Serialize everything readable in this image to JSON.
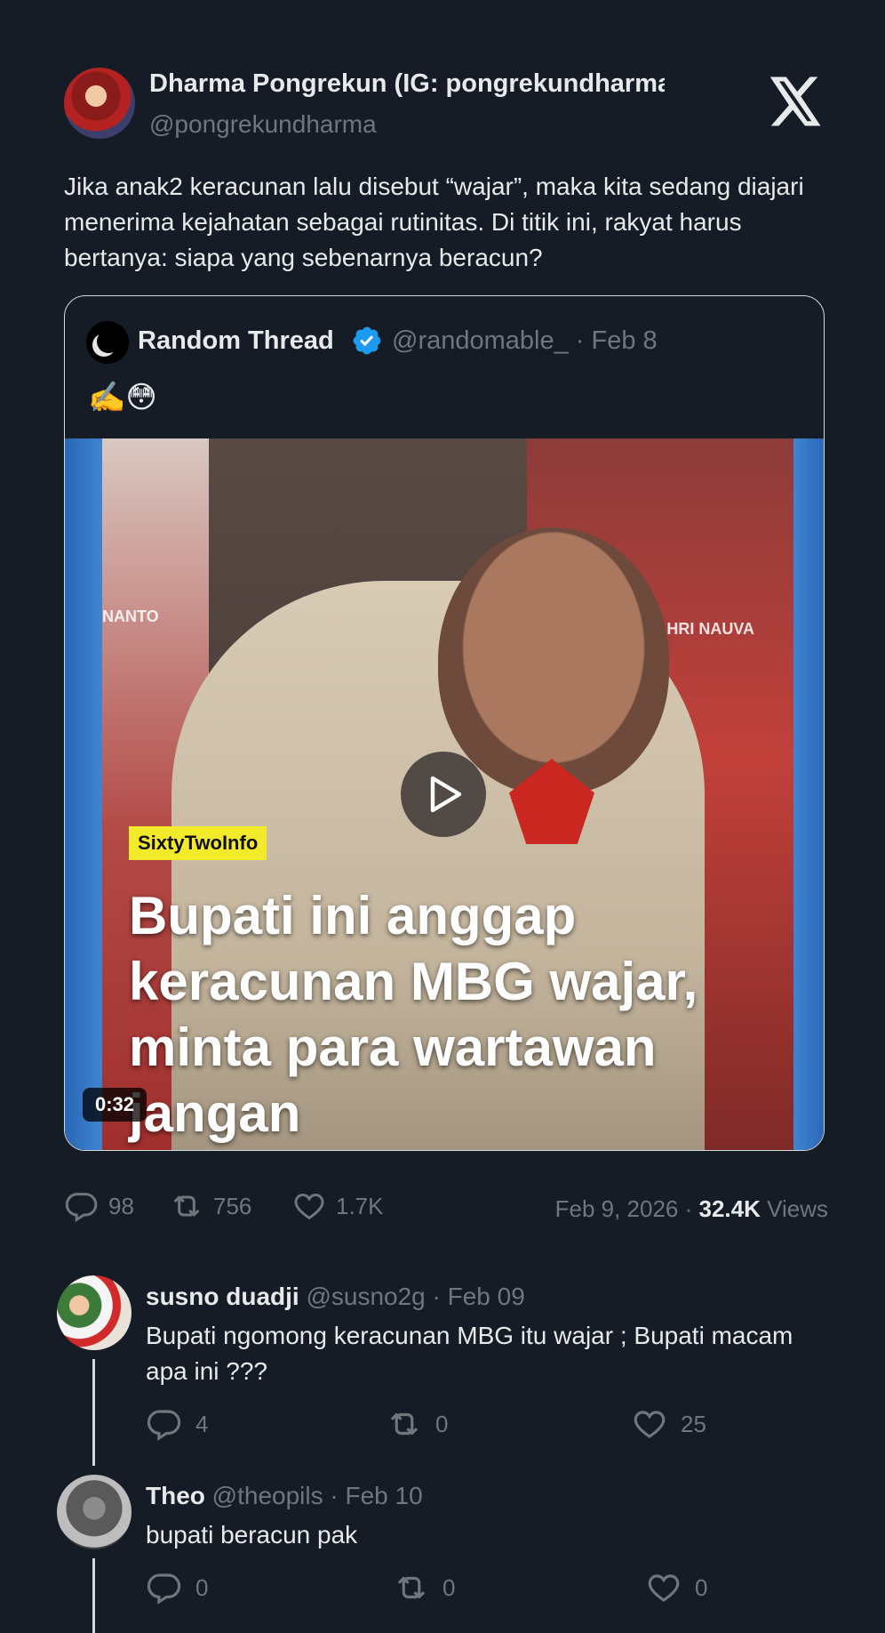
{
  "author": {
    "name": "Dharma Pongrekun (IG: pongrekundharma)",
    "handle": "@pongrekundharma"
  },
  "tweet": {
    "text": "Jika anak2 keracunan lalu disebut “wajar”, maka kita sedang diajari menerima kejahatan sebagai rutinitas. Di titik ini, rakyat harus bertanya: siapa yang sebenarnya beracun?"
  },
  "quote": {
    "name": "Random Thread",
    "handle_date": "@randomable_ · Feb 8",
    "emojis": "✍️😳",
    "video": {
      "source_tag": "SixtyTwoInfo",
      "headline": "Bupati ini anggap keracunan    MBG wajar, minta para wartawan jangan",
      "duration": "0:32",
      "banner_left": "NANTO",
      "banner_right": "ALID FATHUL BAHRI  NAUVA"
    }
  },
  "stats": {
    "replies": "98",
    "reposts": "756",
    "likes": "1.7K",
    "date": "Feb 9, 2026 · ",
    "views_count": "32.4K",
    "views_label": " Views"
  },
  "replies": [
    {
      "name": "susno duadji",
      "handle_date": " @susno2g · Feb 09",
      "text": "Bupati ngomong keracunan MBG itu wajar ; Bupati macam apa ini ???",
      "replies": "4",
      "reposts": "0",
      "likes": "25"
    },
    {
      "name": "Theo",
      "handle_date": " @theopils · Feb 10",
      "text": "bupati beracun pak",
      "replies": "0",
      "reposts": "0",
      "likes": "0"
    }
  ],
  "colors": {
    "background": "#151c26",
    "text": "#e7e9ea",
    "muted": "#71767b",
    "verified": "#1d9bf0"
  }
}
